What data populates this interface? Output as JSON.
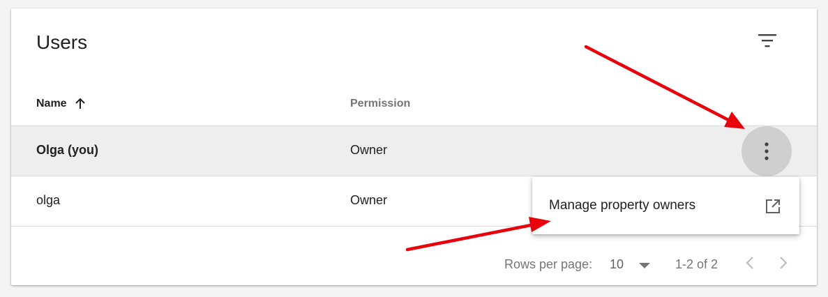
{
  "card": {
    "title": "Users"
  },
  "toolbar": {
    "filter_icon": "filter-list-icon"
  },
  "table": {
    "columns": [
      {
        "label": "Name",
        "sort": "ascending",
        "sort_icon": "arrow-up-icon"
      },
      {
        "label": "Permission"
      }
    ],
    "rows": [
      {
        "name": "Olga (you)",
        "permission": "Owner",
        "highlighted": true
      },
      {
        "name": "olga",
        "permission": "Owner",
        "highlighted": false
      }
    ]
  },
  "row_menu": {
    "button_icon": "more-vert-icon",
    "items": [
      {
        "label": "Manage property owners",
        "icon": "open-in-new-icon"
      }
    ]
  },
  "pagination": {
    "rows_per_page_label": "Rows per page:",
    "rows_per_page_value": "10",
    "range_text": "1-2 of 2",
    "prev_icon": "chevron-left-icon",
    "next_icon": "chevron-right-icon"
  },
  "annotations": {
    "arrow_color": "#e8000b"
  },
  "colors": {
    "hover_row": "#eeeeee",
    "more_button_bg": "#cfcfcf",
    "secondary_text": "#757575"
  }
}
